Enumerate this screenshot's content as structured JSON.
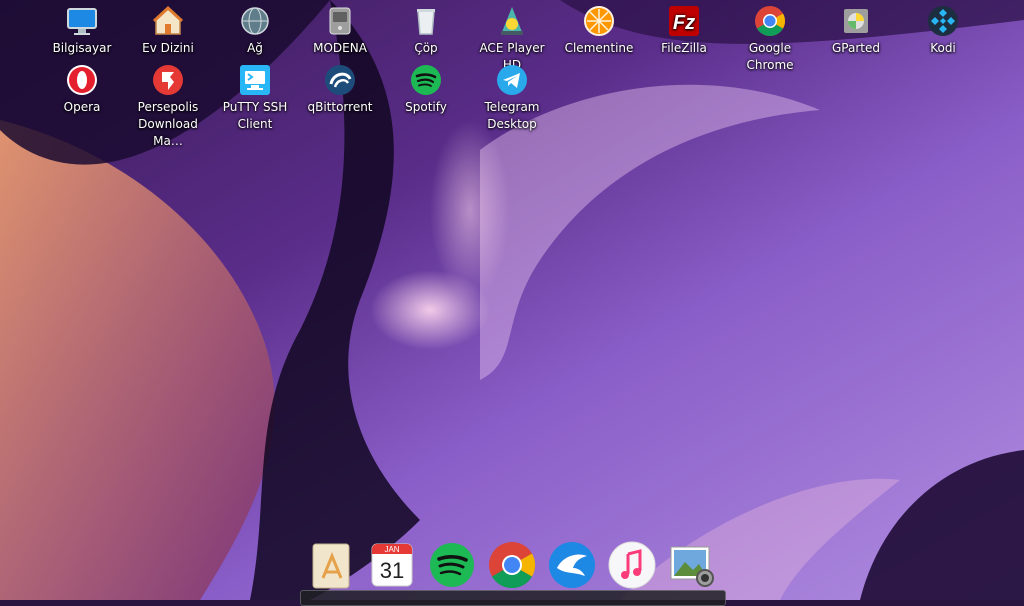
{
  "desktop": {
    "icons": [
      {
        "label": "Bilgisayar",
        "icon": "computer-icon"
      },
      {
        "label": "Ev Dizini",
        "icon": "home-folder-icon"
      },
      {
        "label": "Ağ",
        "icon": "network-globe-icon"
      },
      {
        "label": "MODENA",
        "icon": "drive-icon"
      },
      {
        "label": "Çöp",
        "icon": "trash-icon"
      },
      {
        "label": "ACE Player HD",
        "icon": "ace-player-icon"
      },
      {
        "label": "Clementine",
        "icon": "clementine-icon"
      },
      {
        "label": "FileZilla",
        "icon": "filezilla-icon"
      },
      {
        "label": "Google Chrome",
        "icon": "chrome-icon"
      },
      {
        "label": "GParted",
        "icon": "gparted-icon"
      },
      {
        "label": "Kodi",
        "icon": "kodi-icon"
      },
      {
        "label": "Opera",
        "icon": "opera-icon"
      },
      {
        "label": "Persepolis Download Ma…",
        "icon": "persepolis-icon"
      },
      {
        "label": "PuTTY SSH Client",
        "icon": "putty-icon"
      },
      {
        "label": "qBittorrent",
        "icon": "qbittorrent-icon"
      },
      {
        "label": "Spotify",
        "icon": "spotify-icon"
      },
      {
        "label": "Telegram Desktop",
        "icon": "telegram-icon"
      }
    ]
  },
  "dock": {
    "calendar_month": "JAN",
    "calendar_day": "31",
    "items": [
      {
        "icon": "app-store-icon"
      },
      {
        "icon": "calendar-icon"
      },
      {
        "icon": "spotify-icon"
      },
      {
        "icon": "chrome-icon"
      },
      {
        "icon": "eagle-browser-icon"
      },
      {
        "icon": "itunes-icon"
      },
      {
        "icon": "image-viewer-icon"
      }
    ]
  }
}
